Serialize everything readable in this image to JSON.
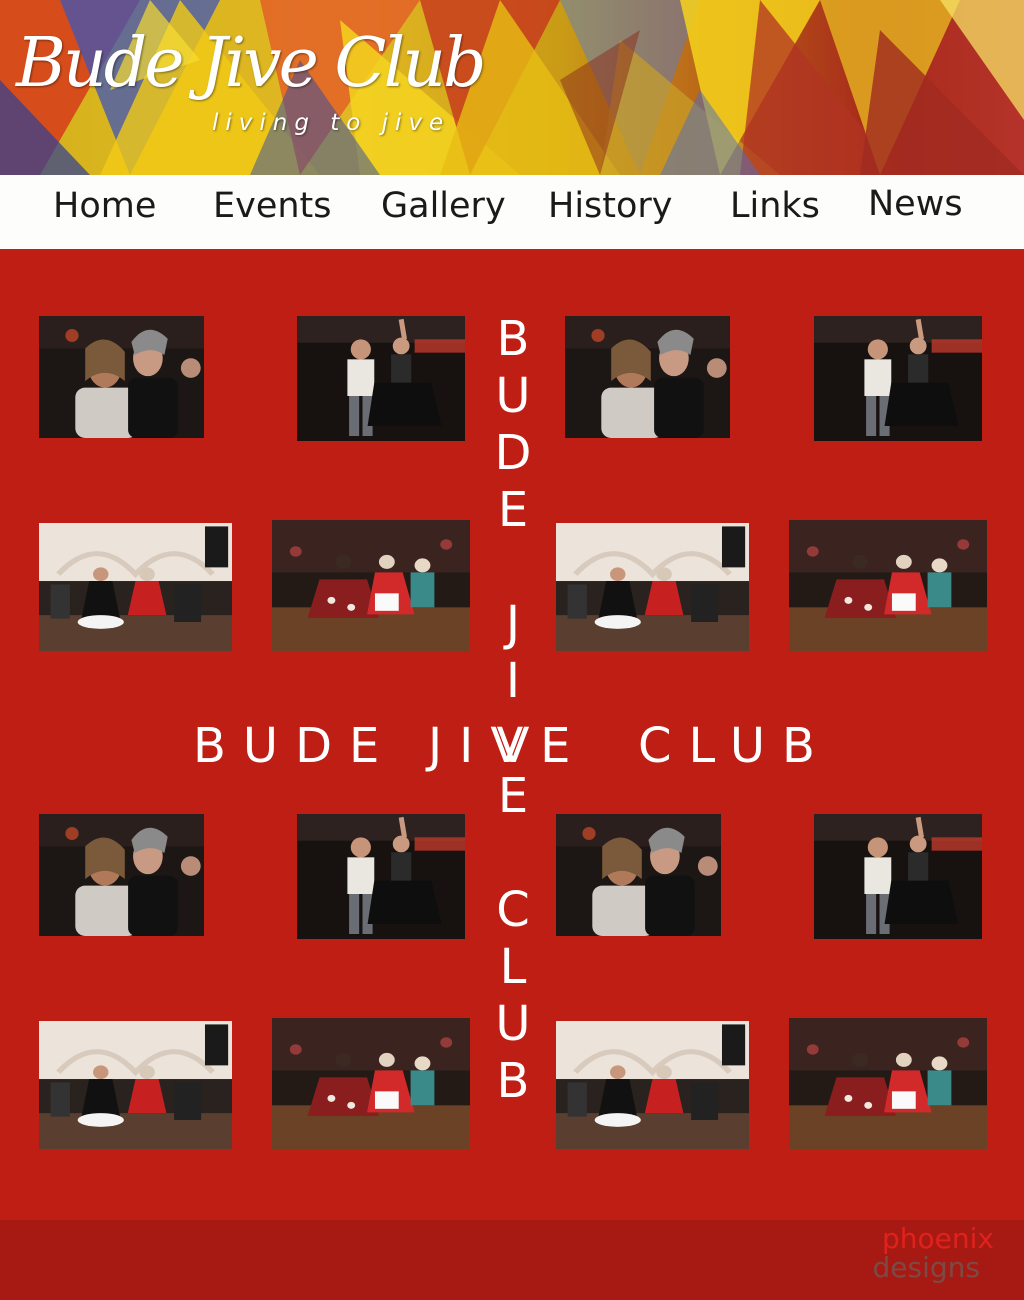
{
  "brand": {
    "title": "Bude Jive Club",
    "tagline": "living to jive"
  },
  "nav": {
    "items": [
      {
        "label": "Home"
      },
      {
        "label": "Events"
      },
      {
        "label": "Gallery"
      },
      {
        "label": "History"
      },
      {
        "label": "Links"
      },
      {
        "label": "News"
      }
    ]
  },
  "main": {
    "vertical_letters": [
      "B",
      "U",
      "D",
      "E",
      "J",
      "I",
      "V",
      "E",
      "C",
      "L",
      "U",
      "B"
    ],
    "horizontal_words": [
      "BUDE",
      "JIVE",
      "CLUB"
    ],
    "photos": [
      {
        "scene": "couple-closeup"
      },
      {
        "scene": "couple-spin"
      },
      {
        "scene": "couple-closeup"
      },
      {
        "scene": "couple-spin"
      },
      {
        "scene": "hall-dancers"
      },
      {
        "scene": "floor-dancers"
      },
      {
        "scene": "hall-dancers"
      },
      {
        "scene": "floor-dancers"
      },
      {
        "scene": "couple-closeup"
      },
      {
        "scene": "couple-spin"
      },
      {
        "scene": "couple-closeup"
      },
      {
        "scene": "couple-spin"
      },
      {
        "scene": "hall-dancers"
      },
      {
        "scene": "floor-dancers"
      },
      {
        "scene": "hall-dancers"
      },
      {
        "scene": "floor-dancers"
      }
    ]
  },
  "footer": {
    "credit_line1": "phoenix",
    "credit_line2": "designs"
  },
  "colors": {
    "page_background": "#bf1e14",
    "nav_background": "#fdfdfb",
    "footer_background": "#a61a13",
    "credit_red": "#e0211c",
    "credit_brown": "#7c4a45"
  }
}
